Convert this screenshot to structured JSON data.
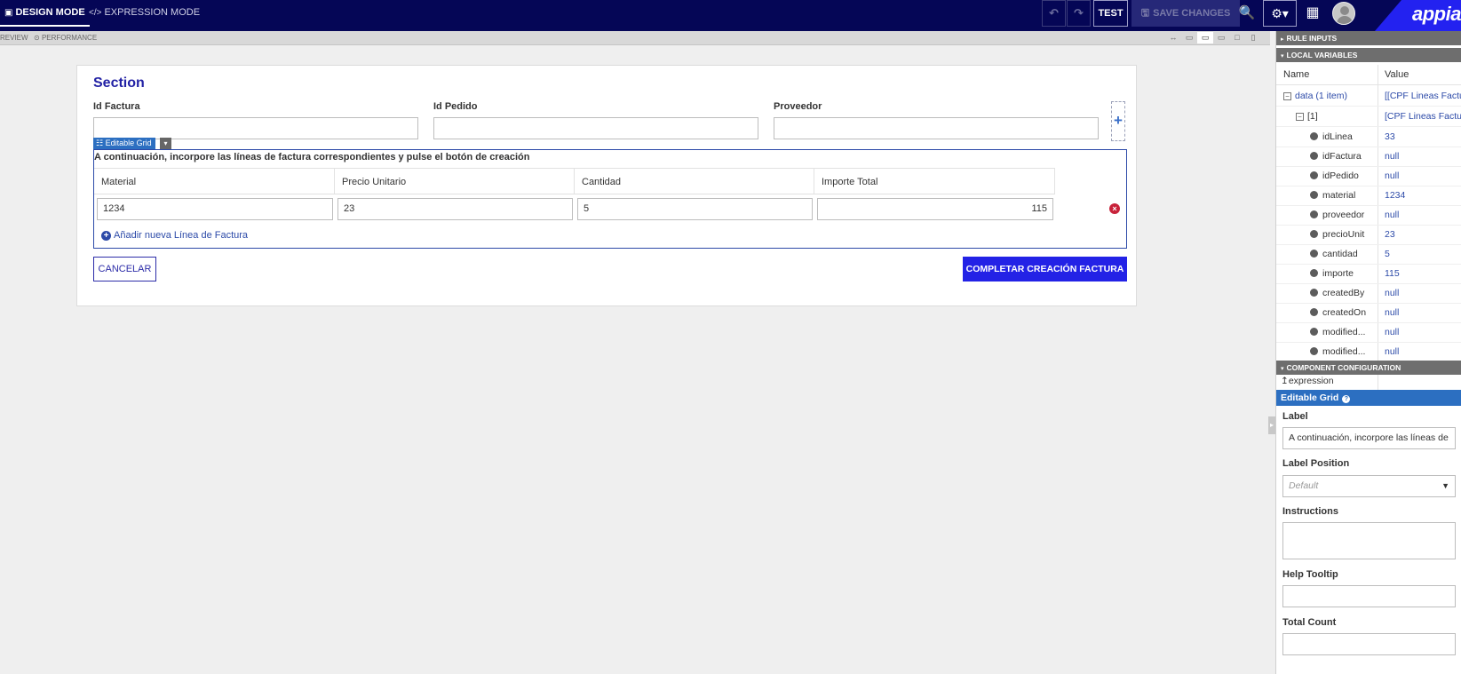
{
  "topbar": {
    "design_mode": "DESIGN MODE",
    "expression_mode": "EXPRESSION MODE",
    "test_label": "TEST",
    "save_label": "SAVE CHANGES",
    "logo_text": "appian"
  },
  "subbar": {
    "preview_label": "REVIEW",
    "performance_label": "PERFORMANCE"
  },
  "form": {
    "section_title": "Section",
    "fields": [
      {
        "label": "Id Factura",
        "value": ""
      },
      {
        "label": "Id Pedido",
        "value": ""
      },
      {
        "label": "Proveedor",
        "value": ""
      }
    ],
    "grid_tag": "Editable Grid",
    "grid_label": "A continuación, incorpore las líneas de factura correspondientes y pulse el botón de creación",
    "columns": [
      "Material",
      "Precio Unitario",
      "Cantidad",
      "Importe Total"
    ],
    "rows": [
      {
        "material": "1234",
        "precio": "23",
        "cantidad": "5",
        "importe": "115"
      }
    ],
    "add_row_label": "Añadir nueva Línea de Factura",
    "cancel_label": "CANCELAR",
    "complete_label": "COMPLETAR CREACIÓN FACTURA"
  },
  "panel": {
    "rule_inputs": "RULE INPUTS",
    "local_variables": "LOCAL VARIABLES",
    "col_name": "Name",
    "col_value": "Value",
    "data_row": {
      "name": "data (1 item)",
      "value": "[[CPF Lineas Factura"
    },
    "item_row": {
      "name": "[1]",
      "value": "[CPF Lineas Factura"
    },
    "fields": [
      {
        "name": "idLinea",
        "value": "33"
      },
      {
        "name": "idFactura",
        "value": "null"
      },
      {
        "name": "idPedido",
        "value": "null"
      },
      {
        "name": "material",
        "value": "1234"
      },
      {
        "name": "proveedor",
        "value": "null"
      },
      {
        "name": "precioUnit",
        "value": "23"
      },
      {
        "name": "cantidad",
        "value": "5"
      },
      {
        "name": "importe",
        "value": "115"
      },
      {
        "name": "createdBy",
        "value": "null"
      },
      {
        "name": "createdOn",
        "value": "null"
      },
      {
        "name": "modified...",
        "value": "null"
      },
      {
        "name": "modified...",
        "value": "null"
      }
    ],
    "component_configuration": "COMPONENT CONFIGURATION",
    "expression_label": "expression",
    "component_name": "Editable Grid",
    "label_caption": "Label",
    "label_value": "A continuación, incorpore las líneas de",
    "label_position_caption": "Label Position",
    "label_position_value": "Default",
    "instructions_caption": "Instructions",
    "help_tooltip_caption": "Help Tooltip",
    "total_count_caption": "Total Count"
  }
}
